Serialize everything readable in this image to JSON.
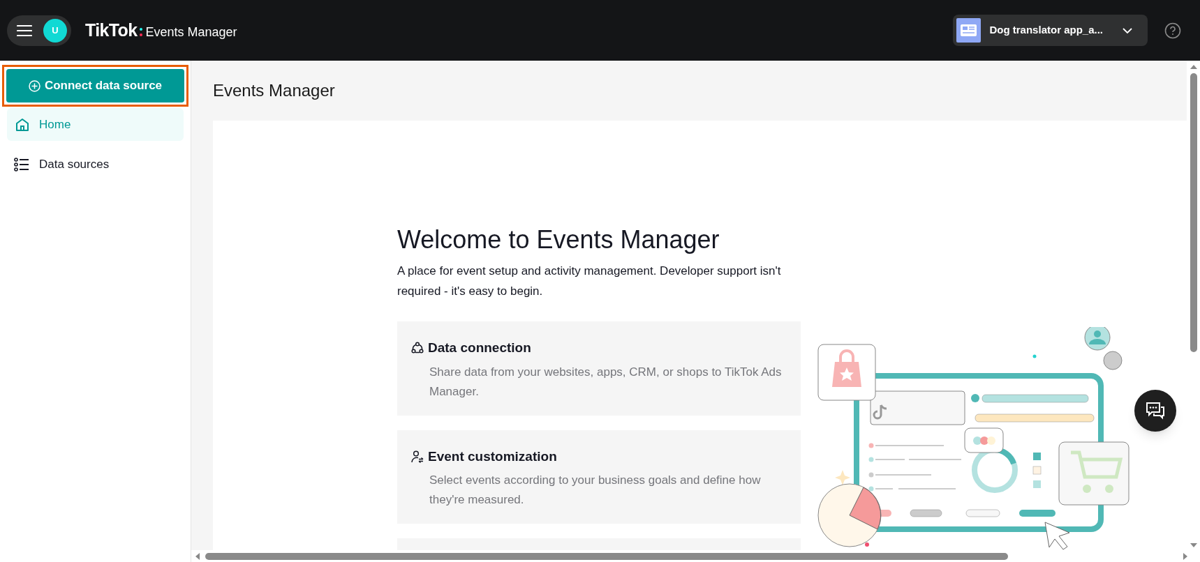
{
  "top_bar": {
    "avatar_initial": "U",
    "brand": "TikTok",
    "product": "Events Manager",
    "account": "Dog translator app_a..."
  },
  "sidebar": {
    "primary_button": "Connect data source",
    "primary_button_highlighted": true,
    "items": [
      {
        "label": "Home",
        "selected": true
      },
      {
        "label": "Data sources",
        "selected": false
      }
    ]
  },
  "page_title": "Events Manager",
  "welcome": {
    "heading": "Welcome to Events Manager",
    "description": "A place for event setup and activity management. Developer support isn't required - it's easy to begin.",
    "cards": [
      {
        "title": "Data connection",
        "description": "Share data from your websites, apps, CRM, or shops to TikTok Ads Manager."
      },
      {
        "title": "Event customization",
        "description": "Select events according to your business goals and define how they're measured."
      }
    ]
  }
}
